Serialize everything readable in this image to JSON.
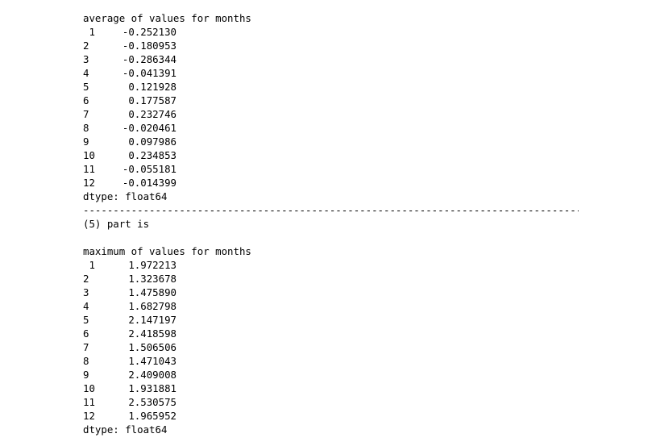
{
  "block1": {
    "header": "average of values for months",
    "rows": [
      {
        "index": " 1",
        "value": "-0.252130"
      },
      {
        "index": "2",
        "value": "-0.180953"
      },
      {
        "index": "3",
        "value": "-0.286344"
      },
      {
        "index": "4",
        "value": "-0.041391"
      },
      {
        "index": "5",
        "value": "0.121928"
      },
      {
        "index": "6",
        "value": "0.177587"
      },
      {
        "index": "7",
        "value": "0.232746"
      },
      {
        "index": "8",
        "value": "-0.020461"
      },
      {
        "index": "9",
        "value": "0.097986"
      },
      {
        "index": "10",
        "value": "0.234853"
      },
      {
        "index": "11",
        "value": "-0.055181"
      },
      {
        "index": "12",
        "value": "-0.014399"
      }
    ],
    "dtype": "dtype: float64"
  },
  "separator": "--------------------------------------------------------------------------------------------",
  "part_label": "(5) part is",
  "block2": {
    "header": "maximum of values for months",
    "rows": [
      {
        "index": " 1",
        "value": "1.972213"
      },
      {
        "index": "2",
        "value": "1.323678"
      },
      {
        "index": "3",
        "value": "1.475890"
      },
      {
        "index": "4",
        "value": "1.682798"
      },
      {
        "index": "5",
        "value": "2.147197"
      },
      {
        "index": "6",
        "value": "2.418598"
      },
      {
        "index": "7",
        "value": "1.506506"
      },
      {
        "index": "8",
        "value": "1.471043"
      },
      {
        "index": "9",
        "value": "2.409008"
      },
      {
        "index": "10",
        "value": "1.931881"
      },
      {
        "index": "11",
        "value": "2.530575"
      },
      {
        "index": "12",
        "value": "1.965952"
      }
    ],
    "dtype": "dtype: float64"
  }
}
